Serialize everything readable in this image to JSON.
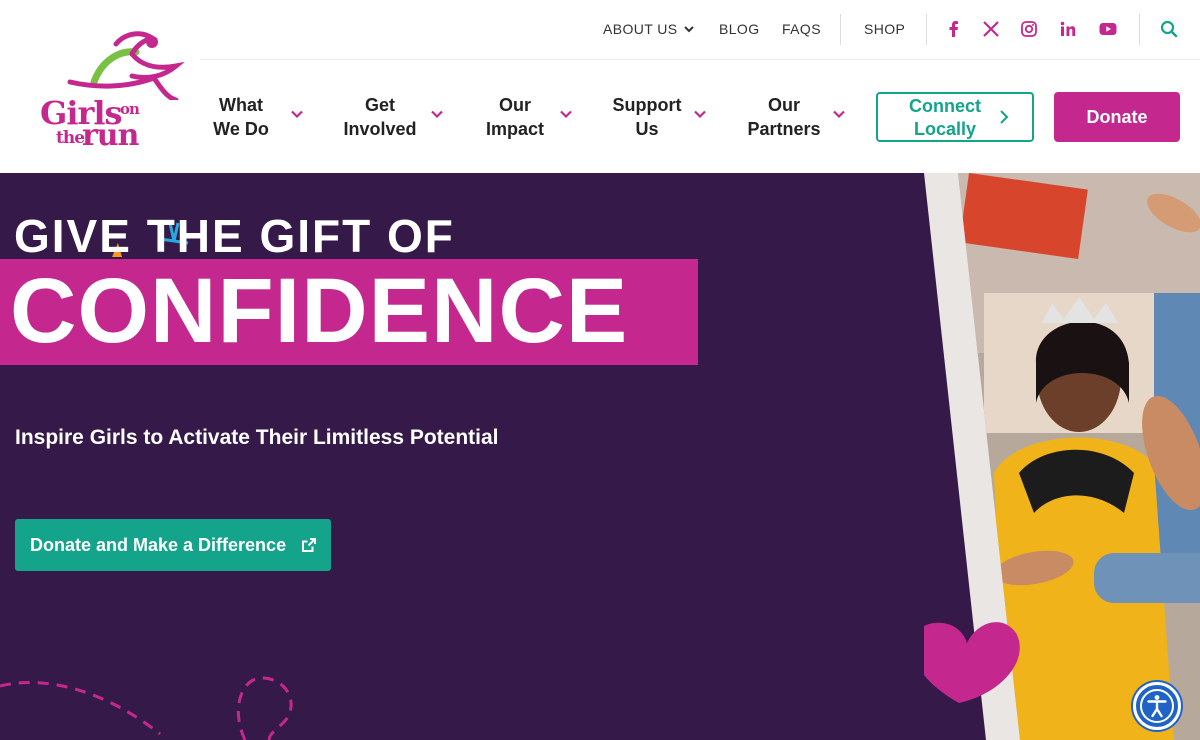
{
  "brand": {
    "logo_lines": [
      "Girls",
      "on",
      "the",
      "run"
    ],
    "pink": "#c4288f",
    "teal": "#14a38b",
    "purple": "#351a49"
  },
  "utility_nav": {
    "about_label": "ABOUT US",
    "blog_label": "BLOG",
    "faqs_label": "FAQS",
    "shop_label": "SHOP",
    "social_icons": [
      "facebook-icon",
      "x-icon",
      "instagram-icon",
      "linkedin-icon",
      "youtube-icon"
    ],
    "search_icon": "search-icon"
  },
  "main_nav": [
    {
      "line1": "What",
      "line2": "We Do"
    },
    {
      "line1": "Get",
      "line2": "Involved"
    },
    {
      "line1": "Our",
      "line2": "Impact"
    },
    {
      "line1": "Support",
      "line2": "Us"
    },
    {
      "line1": "Our",
      "line2": "Partners"
    }
  ],
  "header_buttons": {
    "connect_line1": "Connect",
    "connect_line2": "Locally",
    "donate_label": "Donate"
  },
  "hero": {
    "title_top": "GIVE THE GIFT OF",
    "title_main": "CONFIDENCE",
    "subtitle": "Inspire Girls to Activate Their Limitless Potential",
    "cta_label": "Donate and Make a Difference"
  }
}
